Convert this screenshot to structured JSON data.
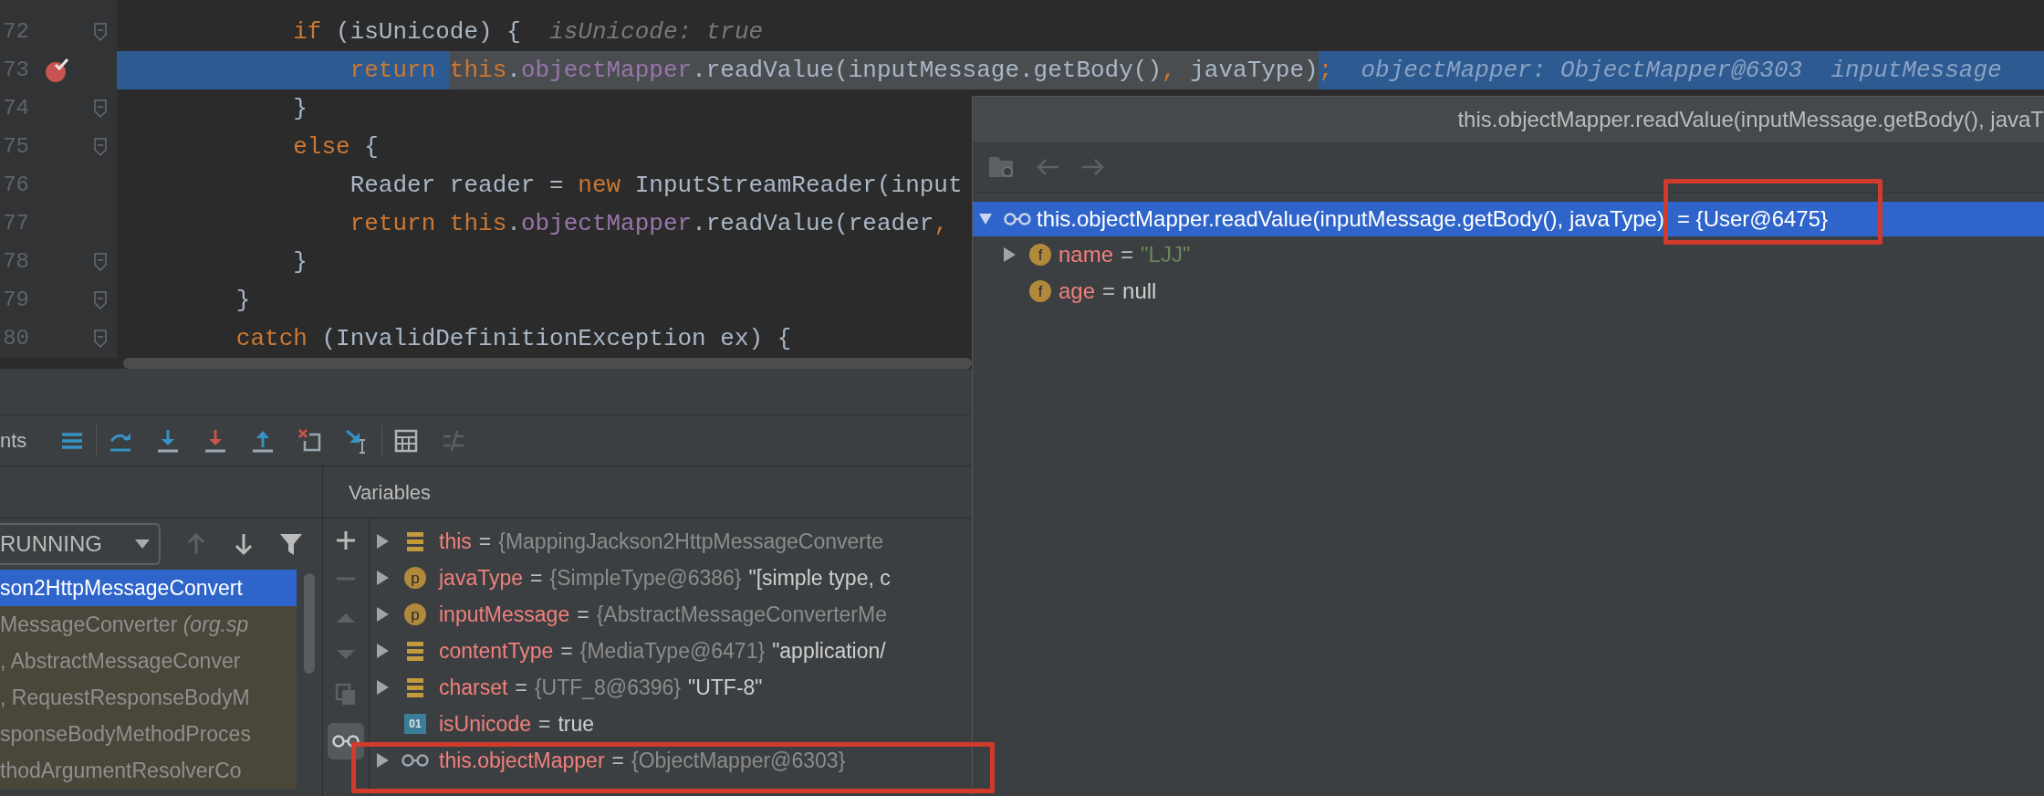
{
  "editor": {
    "lines": [
      {
        "number": "72",
        "breakpoint": false,
        "current": false,
        "fold": true,
        "segments": [
          {
            "text": "            if",
            "kind": "keyword",
            "evaluated": false
          },
          {
            "text": " (isUnicode) {",
            "kind": "plain",
            "evaluated": false
          },
          {
            "text": "isUnicode: true",
            "kind": "hint",
            "evaluated": false
          }
        ]
      },
      {
        "number": "73",
        "breakpoint": true,
        "current": true,
        "fold": false,
        "segments": [
          {
            "text": "                return ",
            "kind": "keyword",
            "evaluated": false
          },
          {
            "text": "this",
            "kind": "keyword",
            "evaluated": true
          },
          {
            "text": ".",
            "kind": "plain",
            "evaluated": true
          },
          {
            "text": "objectMapper",
            "kind": "field",
            "evaluated": true
          },
          {
            "text": ".readValue(inputMessage.getBody()",
            "kind": "plain",
            "evaluated": true
          },
          {
            "text": ", ",
            "kind": "keyword",
            "evaluated": true
          },
          {
            "text": "javaType)",
            "kind": "plain",
            "evaluated": true
          },
          {
            "text": ";",
            "kind": "keyword",
            "evaluated": false
          },
          {
            "text": "objectMapper: ObjectMapper@6303",
            "kind": "hint",
            "evaluated": false
          },
          {
            "text": "inputMessage",
            "kind": "hint",
            "evaluated": false
          }
        ]
      },
      {
        "number": "74",
        "breakpoint": false,
        "current": false,
        "fold": true,
        "segments": [
          {
            "text": "            }",
            "kind": "plain",
            "evaluated": false
          }
        ]
      },
      {
        "number": "75",
        "breakpoint": false,
        "current": false,
        "fold": true,
        "segments": [
          {
            "text": "            else",
            "kind": "keyword",
            "evaluated": false
          },
          {
            "text": " {",
            "kind": "plain",
            "evaluated": false
          }
        ]
      },
      {
        "number": "76",
        "breakpoint": false,
        "current": false,
        "fold": false,
        "segments": [
          {
            "text": "                Reader reader = ",
            "kind": "plain",
            "evaluated": false
          },
          {
            "text": "new",
            "kind": "keyword",
            "evaluated": false
          },
          {
            "text": " InputStreamReader(input",
            "kind": "plain",
            "evaluated": false
          }
        ]
      },
      {
        "number": "77",
        "breakpoint": false,
        "current": false,
        "fold": false,
        "segments": [
          {
            "text": "                return ",
            "kind": "keyword",
            "evaluated": false
          },
          {
            "text": "this",
            "kind": "keyword",
            "evaluated": false
          },
          {
            "text": ".",
            "kind": "plain",
            "evaluated": false
          },
          {
            "text": "objectMapper",
            "kind": "field",
            "evaluated": false
          },
          {
            "text": ".readValue(reader",
            "kind": "plain",
            "evaluated": false
          },
          {
            "text": ",",
            "kind": "keyword",
            "evaluated": false
          }
        ]
      },
      {
        "number": "78",
        "breakpoint": false,
        "current": false,
        "fold": true,
        "segments": [
          {
            "text": "            }",
            "kind": "plain",
            "evaluated": false
          }
        ]
      },
      {
        "number": "79",
        "breakpoint": false,
        "current": false,
        "fold": true,
        "segments": [
          {
            "text": "        }",
            "kind": "plain",
            "evaluated": false
          }
        ]
      },
      {
        "number": "80",
        "breakpoint": false,
        "current": false,
        "fold": true,
        "segments": [
          {
            "text": "        catch",
            "kind": "keyword",
            "evaluated": false
          },
          {
            "text": " (InvalidDefinitionException ex) {",
            "kind": "plain",
            "evaluated": false
          }
        ]
      }
    ]
  },
  "debugger": {
    "toolbar_label": "nts",
    "variables_title": "Variables",
    "thread": {
      "value": "RUNNING"
    },
    "frames": [
      {
        "text": "son2HttpMessageConvert",
        "selected": true
      },
      {
        "text": "MessageConverter *(org.sp*",
        "selected": false
      },
      {
        "text": ", AbstractMessageConver",
        "selected": false
      },
      {
        "text": ", RequestResponseBodyM",
        "selected": false
      },
      {
        "text": "sponseBodyMethodProces",
        "selected": false
      },
      {
        "text": "thodArgumentResolverCo",
        "selected": false
      }
    ],
    "watches_toggle": {
      "on": true
    },
    "variables": [
      {
        "kind": "object",
        "expandable": true,
        "name": "this",
        "operator": "=",
        "ref": "{MappingJackson2HttpMessageConverte"
      },
      {
        "kind": "param",
        "badge": "p",
        "expandable": true,
        "name": "javaType",
        "operator": "=",
        "ref": "{SimpleType@6386}",
        "detail": "\"[simple type, c"
      },
      {
        "kind": "param",
        "badge": "p",
        "expandable": true,
        "name": "inputMessage",
        "operator": "=",
        "ref": "{AbstractMessageConverterMe"
      },
      {
        "kind": "object",
        "expandable": true,
        "name": "contentType",
        "operator": "=",
        "ref": "{MediaType@6471}",
        "detail": "\"application/"
      },
      {
        "kind": "object",
        "expandable": true,
        "name": "charset",
        "operator": "=",
        "ref": "{UTF_8@6396}",
        "detail": "\"UTF-8\""
      },
      {
        "kind": "primitive",
        "badge": "01",
        "expandable": false,
        "name": "isUnicode",
        "operator": "=",
        "detail": "true"
      },
      {
        "kind": "watch",
        "expandable": true,
        "name": "this.objectMapper",
        "operator": "=",
        "ref": "{ObjectMapper@6303}"
      }
    ]
  },
  "popup": {
    "title": "this.objectMapper.readValue(inputMessage.getBody(), javaT",
    "root": {
      "expression": "this.objectMapper.readValue(inputMessage.getBody(), javaType)",
      "value": "= {User@6475}",
      "expanded": true,
      "selected": true,
      "children": [
        {
          "badge": "f",
          "expandable": true,
          "name": "name",
          "operator": "=",
          "value": "\"LJJ\"",
          "kind": "string"
        },
        {
          "badge": "f",
          "expandable": false,
          "name": "age",
          "operator": "=",
          "value": "null",
          "kind": "literal"
        }
      ]
    }
  }
}
